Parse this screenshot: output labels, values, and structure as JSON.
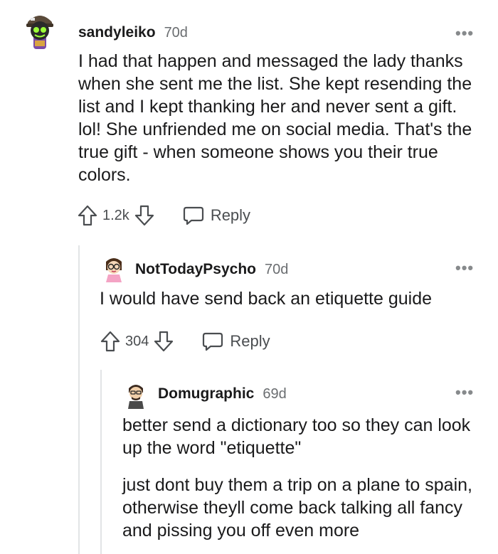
{
  "comments": [
    {
      "username": "sandyleiko",
      "age": "70d",
      "paragraphs": [
        "I had that happen and messaged the lady thanks when she sent me the list. She kept resending the list and I kept thanking her and never sent a gift. lol! She unfriended me on social media. That's the true gift - when someone shows you their true colors."
      ],
      "votes": "1.2k",
      "reply_label": "Reply",
      "more_label": "•••"
    },
    {
      "username": "NotTodayPsycho",
      "age": "70d",
      "paragraphs": [
        "I would have send back an etiquette guide"
      ],
      "votes": "304",
      "reply_label": "Reply",
      "more_label": "•••"
    },
    {
      "username": "Domugraphic",
      "age": "69d",
      "paragraphs": [
        "better send a dictionary too so they can look up the word \"etiquette\"",
        "just dont buy them a trip on a plane to spain, otherwise theyll come back talking all fancy and pissing you off even more"
      ],
      "more_label": "•••"
    }
  ],
  "colors": {
    "text": "#1a1a1b",
    "meta": "#6a6d70",
    "thread_line": "#e2e4e6"
  },
  "icons": [
    "upvote-icon",
    "downvote-icon",
    "reply-bubble-icon",
    "more-options-icon"
  ]
}
